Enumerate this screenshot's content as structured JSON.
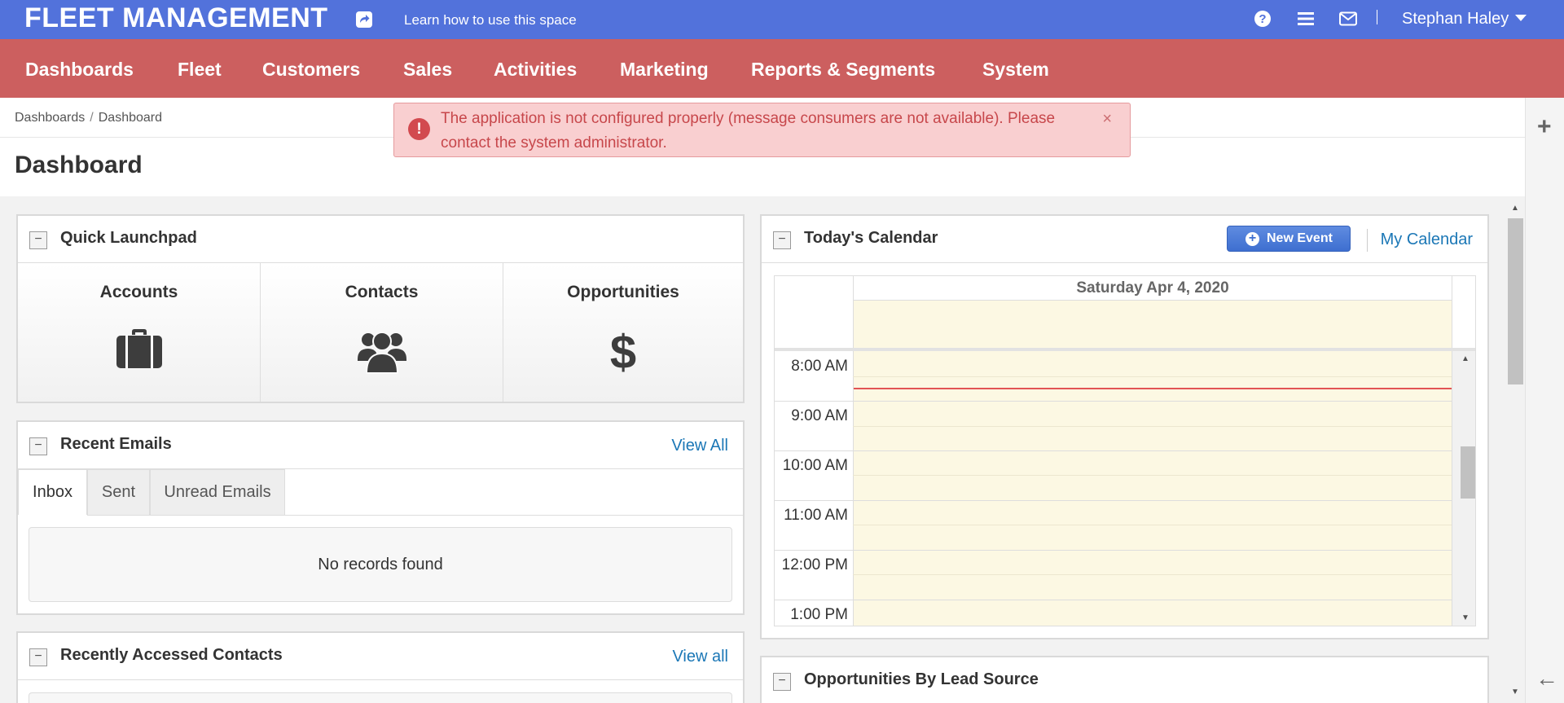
{
  "topbar": {
    "title": "FLEET MANAGEMENT",
    "learn_link": "Learn how to use this space",
    "icons": [
      "share-icon",
      "help-icon",
      "menu-icon",
      "mail-icon"
    ],
    "user": "Stephan Haley"
  },
  "nav": {
    "items": [
      "Dashboards",
      "Fleet",
      "Customers",
      "Sales",
      "Activities",
      "Marketing",
      "Reports & Segments",
      "System"
    ]
  },
  "breadcrumb": [
    "Dashboards",
    "Dashboard"
  ],
  "page_title": "Dashboard",
  "alert": {
    "message": "The application is not configured properly (message consumers are not available). Please contact the system administrator.",
    "close": "×"
  },
  "launchpad": {
    "title": "Quick Launchpad",
    "tiles": [
      {
        "label": "Accounts",
        "icon": "briefcase-icon"
      },
      {
        "label": "Contacts",
        "icon": "users-icon"
      },
      {
        "label": "Opportunities",
        "icon": "dollar-icon"
      }
    ]
  },
  "recent_emails": {
    "title": "Recent Emails",
    "link": "View All",
    "tabs": [
      "Inbox",
      "Sent",
      "Unread Emails"
    ],
    "active_tab": "Inbox",
    "empty": "No records found"
  },
  "recent_contacts": {
    "title": "Recently Accessed Contacts",
    "link": "View all"
  },
  "calendar": {
    "title": "Today's Calendar",
    "new_event": "New Event",
    "my_calendar": "My Calendar",
    "day": "Saturday Apr 4, 2020",
    "times": [
      "8:00 AM",
      "9:00 AM",
      "10:00 AM",
      "11:00 AM",
      "12:00 PM",
      "1:00 PM"
    ]
  },
  "opportunities_widget": {
    "title": "Opportunities By Lead Source"
  },
  "colors": {
    "topbar": "#5272db",
    "nav": "#cc5f5f",
    "alert_bg": "#f9cfd0",
    "link": "#1b77b6",
    "calendar_day": "#fcf8e3",
    "now_line": "#e25454"
  }
}
